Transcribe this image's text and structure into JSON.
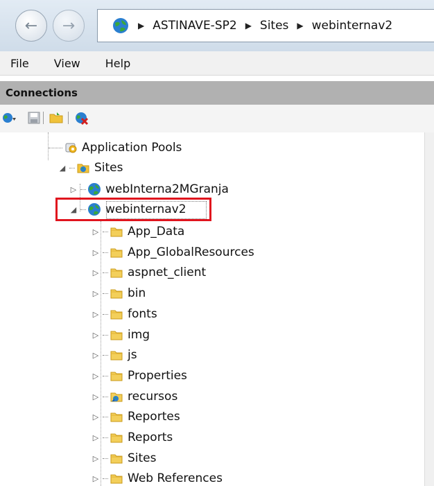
{
  "breadcrumb": [
    "ASTINAVE-SP2",
    "Sites",
    "webinternav2"
  ],
  "menu": [
    "File",
    "View",
    "Help"
  ],
  "connections": {
    "title": "Connections"
  },
  "toolbar": {
    "icons": [
      "connect-icon",
      "save-icon",
      "folder-icon",
      "disconnect-icon"
    ]
  },
  "tree": {
    "nodes": [
      {
        "label": "Application Pools",
        "icon": "app-pools-icon",
        "expander": ""
      },
      {
        "label": "Sites",
        "icon": "sites-icon",
        "expander": "expanded"
      },
      {
        "label": "webInterna2MGranja",
        "icon": "globe-icon",
        "expander": "collapsed"
      },
      {
        "label": "webinternav2",
        "icon": "globe-icon",
        "expander": "expanded",
        "selected": true
      },
      {
        "label": "App_Data",
        "icon": "folder-icon",
        "expander": "collapsed"
      },
      {
        "label": "App_GlobalResources",
        "icon": "folder-icon",
        "expander": "collapsed"
      },
      {
        "label": "aspnet_client",
        "icon": "folder-icon",
        "expander": "collapsed"
      },
      {
        "label": "bin",
        "icon": "folder-icon",
        "expander": "collapsed"
      },
      {
        "label": "fonts",
        "icon": "folder-icon",
        "expander": "collapsed"
      },
      {
        "label": "img",
        "icon": "folder-icon",
        "expander": "collapsed"
      },
      {
        "label": "js",
        "icon": "folder-icon",
        "expander": "collapsed"
      },
      {
        "label": "Properties",
        "icon": "folder-icon",
        "expander": "collapsed"
      },
      {
        "label": "recursos",
        "icon": "virtual-dir-icon",
        "expander": "collapsed"
      },
      {
        "label": "Reportes",
        "icon": "folder-icon",
        "expander": "collapsed"
      },
      {
        "label": "Reports",
        "icon": "folder-icon",
        "expander": "collapsed"
      },
      {
        "label": "Sites",
        "icon": "folder-icon",
        "expander": "collapsed"
      },
      {
        "label": "Web References",
        "icon": "folder-icon",
        "expander": "collapsed"
      }
    ]
  },
  "colors": {
    "selection_outline": "#e0141e",
    "header_bg": "#b1b1b1"
  }
}
